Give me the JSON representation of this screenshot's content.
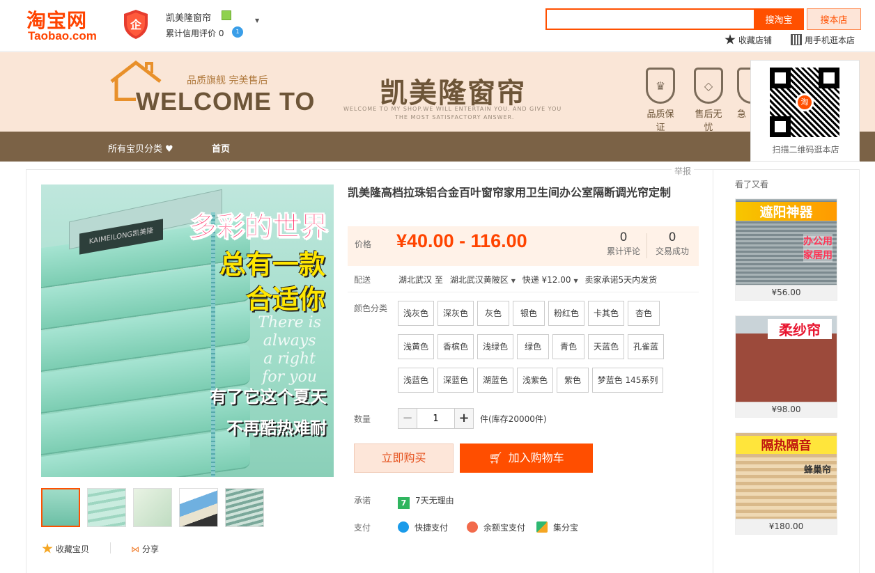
{
  "header": {
    "logo_cn": "淘宝网",
    "logo_en": "Taobao.com",
    "shop_name": "凯美隆窗帘",
    "credit_label": "累计信用评价",
    "credit_value": "0",
    "credit_badge": "1",
    "search_placeholder": "",
    "search_taobao_label": "搜淘宝",
    "search_shop_label": "搜本店",
    "fav_shop_label": "收藏店铺",
    "mobile_shop_label": "用手机逛本店"
  },
  "banner": {
    "tagline": "品质旗舰 完美售后",
    "welcome": "WELCOME TO",
    "shop_title": "凯美隆窗帘",
    "sub_line1": "WELCOME TO MY SHOP.WE WILL ENTERTAIN YOU. AND GIVE YOU",
    "sub_line2": "THE MOST SATISFACTORY ANSWER.",
    "badges": [
      "品质保证",
      "售后无忧",
      "急"
    ]
  },
  "qr": {
    "label": "扫描二维码逛本店",
    "center": "淘"
  },
  "nav": {
    "category_label": "所有宝贝分类",
    "home_label": "首页"
  },
  "report_label": "举报",
  "product": {
    "title": "凯美隆高档拉珠铝合金百叶窗帘家用卫生间办公室隔断调光帘定制",
    "price_label": "价格",
    "price": "¥40.00 - 116.00",
    "reviews_count": "0",
    "reviews_label": "累计评论",
    "sales_count": "0",
    "sales_label": "交易成功",
    "delivery_label": "配送",
    "delivery_from": "湖北武汉",
    "delivery_to_word": "至",
    "delivery_dest": "湖北武汉黄陂区",
    "delivery_express": "快递 ¥12.00",
    "delivery_promise": "卖家承诺5天内发货",
    "color_label": "颜色分类",
    "colors": [
      "浅灰色",
      "深灰色",
      "灰色",
      "银色",
      "粉红色",
      "卡其色",
      "杏色",
      "浅黄色",
      "香槟色",
      "浅绿色",
      "绿色",
      "青色",
      "天蓝色",
      "孔雀蓝",
      "浅蓝色",
      "深蓝色",
      "湖蓝色",
      "浅紫色",
      "紫色",
      "梦蓝色 145系列"
    ],
    "qty_label": "数量",
    "qty_value": "1",
    "stock_text": "件(库存20000件)",
    "buy_now_label": "立即购买",
    "add_cart_label": "加入购物车",
    "promise_label": "承诺",
    "promise_icon": "7",
    "promise_text": "7天无理由",
    "pay_label": "支付",
    "pay_methods": [
      "快捷支付",
      "余额宝支付",
      "集分宝"
    ],
    "fav_label": "收藏宝贝",
    "share_label": "分享"
  },
  "main_image": {
    "brand": "KAIMEILONG凯美隆",
    "line1": "多彩的世界",
    "line2": "总有一款",
    "line3": "合适你",
    "script1": "There is",
    "script2": "always",
    "script3": "a right",
    "script4": "for you",
    "line4": "有了它这个夏天",
    "line5": "不再酷热难耐"
  },
  "sidebar": {
    "title": "看了又看",
    "items": [
      {
        "headline": "遮阳神器",
        "sub1": "办公用",
        "sub2": "家居用",
        "price": "¥56.00"
      },
      {
        "headline": "柔纱帘",
        "price": "¥98.00"
      },
      {
        "headline": "隔热隔音",
        "sub1": "蜂巢帘",
        "price": "¥180.00"
      }
    ]
  },
  "colors": {
    "accent": "#ff5000",
    "price": "#ff4400",
    "nav_bg": "#7b6246",
    "banner_bg": "#fae6d7"
  }
}
